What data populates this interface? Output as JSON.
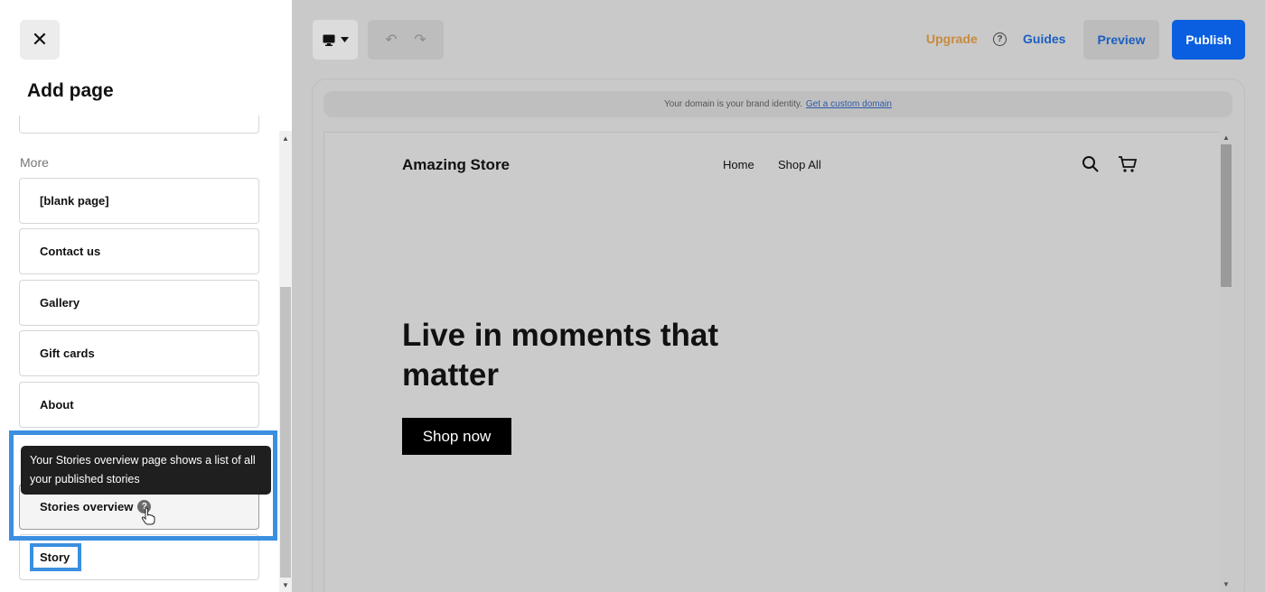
{
  "panel": {
    "close_glyph": "✕",
    "title": "Add page",
    "section_label": "More",
    "pages": [
      {
        "label": "[blank page]"
      },
      {
        "label": "Contact us"
      },
      {
        "label": "Gallery"
      },
      {
        "label": "Gift cards"
      },
      {
        "label": "About"
      },
      {
        "label": "Stories overview"
      },
      {
        "label": "Story"
      }
    ],
    "tooltip": "Your Stories overview page shows a list of all your published stories",
    "help_glyph": "?"
  },
  "toolbar": {
    "undo_glyph": "↶",
    "redo_glyph": "↷",
    "upgrade_label": "Upgrade",
    "help_glyph": "?",
    "guides_label": "Guides",
    "preview_label": "Preview",
    "publish_label": "Publish"
  },
  "domain_bar": {
    "text": "Your domain is your brand identity.",
    "link": "Get a custom domain"
  },
  "site": {
    "store_name": "Amazing Store",
    "nav": [
      "Home",
      "Shop All"
    ],
    "hero_title": "Live in moments that matter",
    "cta_label": "Shop now"
  },
  "icons": [
    "close-icon",
    "desktop-icon",
    "chevron-down-icon",
    "undo-icon",
    "redo-icon",
    "help-icon",
    "search-icon",
    "cart-icon",
    "pointer-hand-icon"
  ],
  "colors": {
    "accent": "#0a5fe0",
    "upgrade": "#c98a3c",
    "link": "#1b5fc1",
    "highlight": "#3b8fe0"
  }
}
